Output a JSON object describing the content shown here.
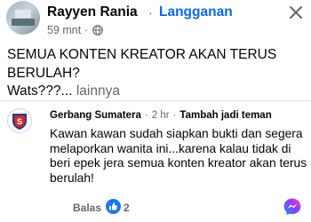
{
  "post": {
    "author": "Rayyen Rania",
    "separator": "·",
    "subscribe_label": "Langganan",
    "time": "59 mnt ·",
    "text": "SEMUA KONTEN KREATOR AKAN TERUS BERULAH?",
    "text_second": "Wats???...",
    "more_label": "lainnya"
  },
  "comment": {
    "author": "Gerbang Sumatera",
    "separator1": "·",
    "time": "2 hr",
    "separator2": "·",
    "follow_label": "Tambah jadi teman",
    "text": "Kawan kawan sudah siapkan bukti dan segera melaporkan wanita ini...karena kalau tidak di beri epek jera semua konten kreator akan terus berulah!",
    "reply_label": "Balas",
    "like_count": "2"
  },
  "colors": {
    "accent": "#0866ff",
    "muted": "#65676b",
    "comment_avatar_red": "#d62828",
    "comment_avatar_blue": "#1c3d8f"
  }
}
